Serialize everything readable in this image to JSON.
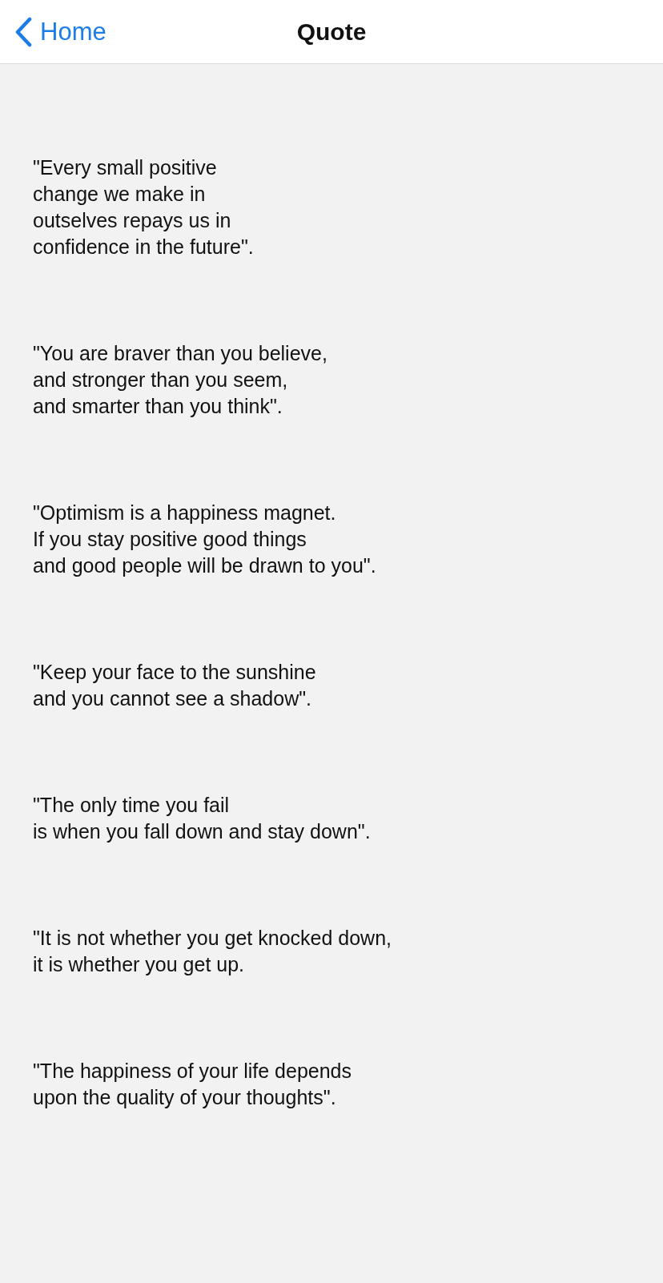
{
  "nav_bar": {
    "back_label": "Home",
    "title": "Quote"
  },
  "quotes": [
    "\"Every small positive\nchange we make in\noutselves repays us in\nconfidence in the future\".",
    "\"You are braver than you believe,\nand stronger than you seem,\nand smarter than you think\".",
    "\"Optimism is a happiness magnet.\nIf you stay positive good things\nand good people will be drawn to you\".",
    "\"Keep your face to the sunshine\nand you cannot see a shadow\".",
    "\"The only time you fail\nis when you fall down and stay down\".",
    "\"It is not whether you get knocked down,\nit is whether you get up.",
    "\"The happiness of your life depends\nupon the quality of your thoughts\"."
  ]
}
